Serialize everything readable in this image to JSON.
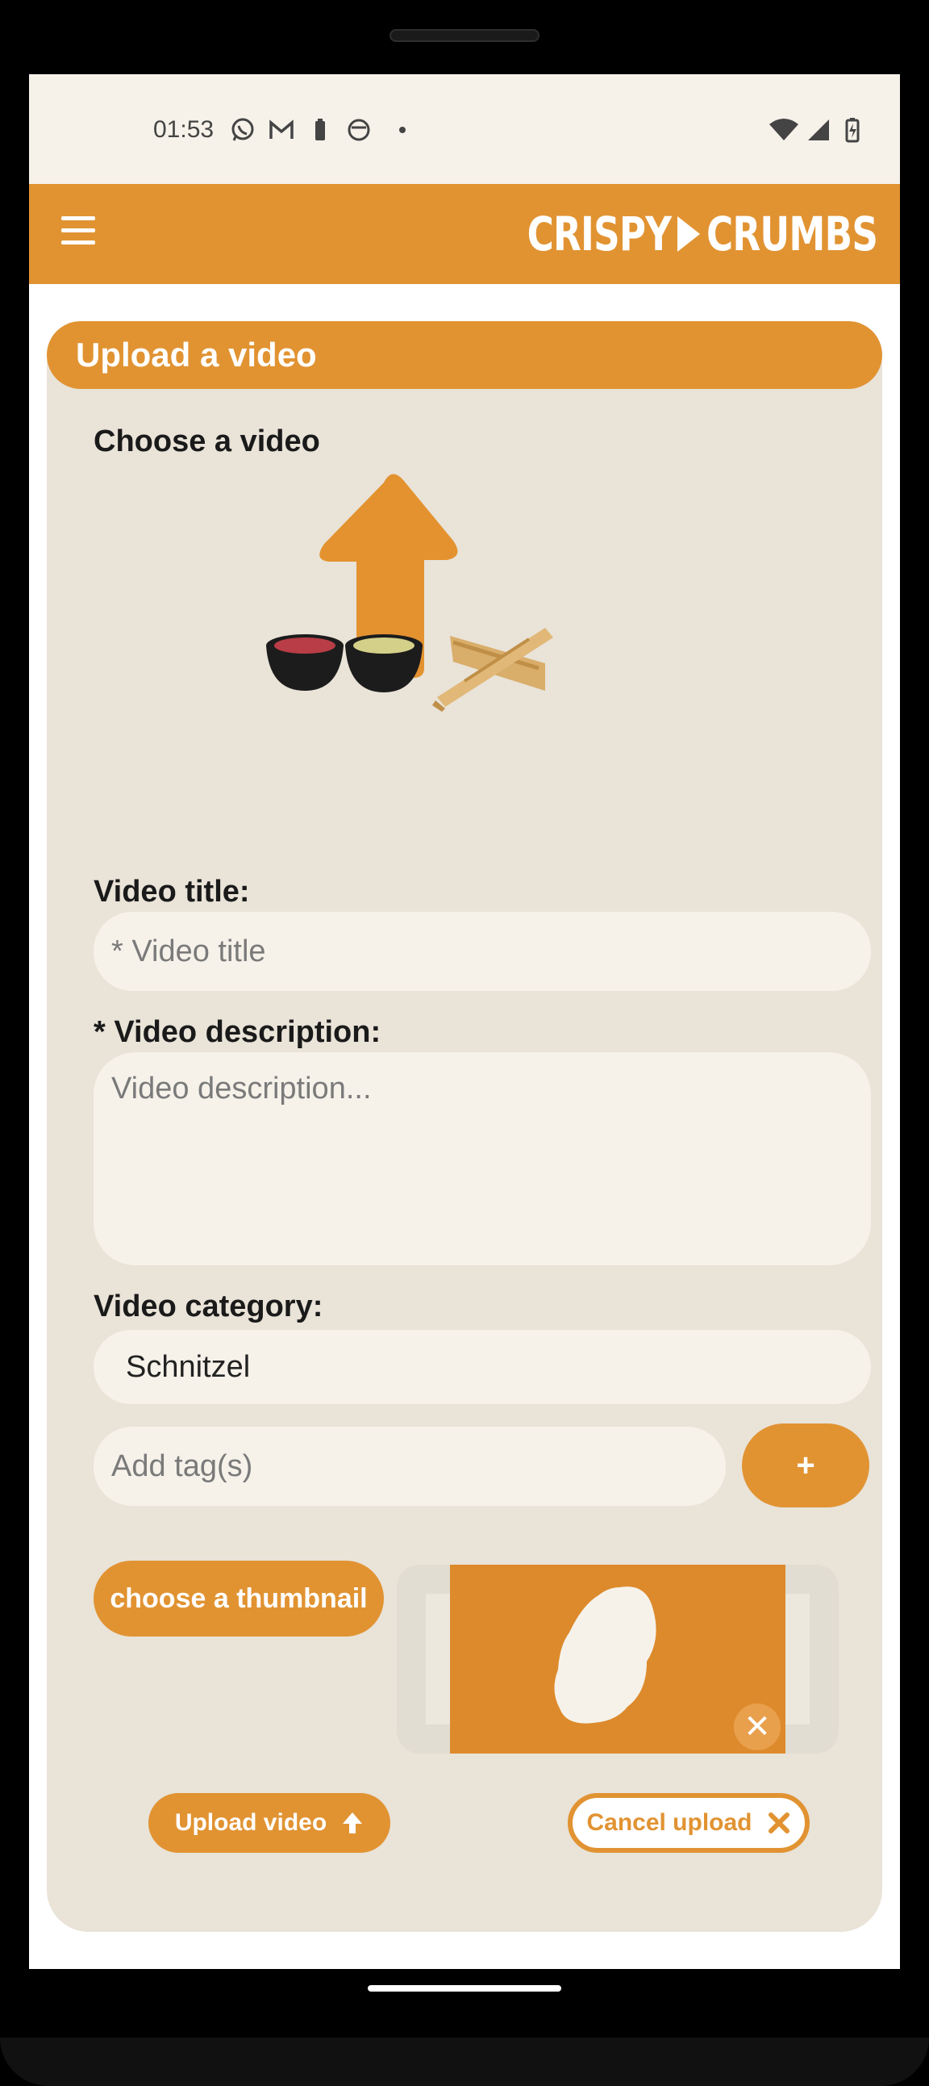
{
  "status": {
    "time": "01:53",
    "icons": [
      "whatsapp-icon",
      "gmail-icon",
      "battery-saver-icon",
      "app-face-icon",
      "dot-icon"
    ],
    "right_icons": [
      "wifi-icon",
      "cell-signal-icon",
      "battery-charging-icon"
    ]
  },
  "appbar": {
    "logo_left": "CRISPY",
    "logo_right": "CRUMBS",
    "color": "#e19332"
  },
  "form": {
    "title": "Upload a video",
    "choose_label": "Choose a video",
    "video_title_label": "Video title:",
    "video_title_placeholder": "* Video title",
    "description_label": "* Video description:",
    "description_placeholder": "Video description...",
    "category_label": "Video category:",
    "category_value": "Schnitzel",
    "tags_placeholder": "Add tag(s)",
    "add_tag_label": "+",
    "thumbnail_button": "choose a thumbnail",
    "thumbnail_close": "✕",
    "upload_button": "Upload video",
    "cancel_button": "Cancel upload"
  },
  "colors": {
    "accent": "#e19332",
    "card": "#e9e3d8",
    "field": "#f6f2ea"
  }
}
